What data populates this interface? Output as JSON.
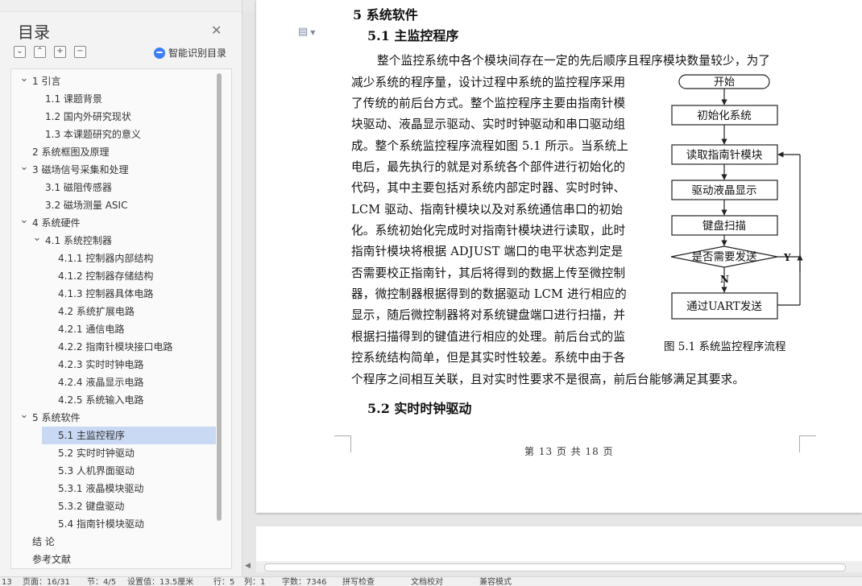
{
  "sidebar": {
    "title": "目录",
    "close_icon": "close-icon",
    "tools": [
      "⌄",
      "⌃",
      "+",
      "−"
    ],
    "ai_label": "智能识别目录",
    "selected_index": 19,
    "items": [
      {
        "label": "1  引言",
        "level": 0,
        "toggle": "expanded"
      },
      {
        "label": "1.1  课题背景",
        "level": 1
      },
      {
        "label": "1.2  国内外研究现状",
        "level": 1
      },
      {
        "label": "1.3  本课题研究的意义",
        "level": 1
      },
      {
        "label": "2  系统框图及原理",
        "level": 0
      },
      {
        "label": "3  磁场信号采集和处理",
        "level": 0,
        "toggle": "expanded"
      },
      {
        "label": "3.1  磁阻传感器",
        "level": 1
      },
      {
        "label": "3.2  磁场测量 ASIC",
        "level": 1
      },
      {
        "label": "4  系统硬件",
        "level": 0,
        "toggle": "expanded"
      },
      {
        "label": "4.1 系统控制器",
        "level": 1,
        "toggle": "expanded"
      },
      {
        "label": "4.1.1  控制器内部结构",
        "level": 2
      },
      {
        "label": "4.1.2  控制器存储结构",
        "level": 2
      },
      {
        "label": "4.1.3  控制器具体电路",
        "level": 2
      },
      {
        "label": "4.2  系统扩展电路",
        "level": 2
      },
      {
        "label": "4.2.1 通信电路",
        "level": 2
      },
      {
        "label": "4.2.2  指南针模块接口电路",
        "level": 2
      },
      {
        "label": "4.2.3  实时时钟电路",
        "level": 2
      },
      {
        "label": "4.2.4  液晶显示电路",
        "level": 2
      },
      {
        "label": "4.2.5 系统输入电路",
        "level": 2
      },
      {
        "label": "5  系统软件",
        "level": 0,
        "toggle": "expanded"
      },
      {
        "label": "5.1  主监控程序",
        "level": 2
      },
      {
        "label": "5.2  实时时钟驱动",
        "level": 2
      },
      {
        "label": "5.3  人机界面驱动",
        "level": 2
      },
      {
        "label": "5.3.1  液晶模块驱动",
        "level": 2
      },
      {
        "label": "5.3.2  键盘驱动",
        "level": 2
      },
      {
        "label": "5.4  指南针模块驱动",
        "level": 2
      },
      {
        "label": "结      论",
        "level": 0
      },
      {
        "label": "参考文献",
        "level": 0
      }
    ]
  },
  "document": {
    "cut_heading": "5  系统软件",
    "section_heading": "5.1  主监控程序",
    "paragraph_lines": [
      "整个监控系统中各个模块间存在一定的先后顺序且程序模块数量较少，为了",
      "减少系统的程序量，设计过程中系统的监控程序采用",
      "了传统的前后台方式。整个监控程序主要由指南针模",
      "块驱动、液晶显示驱动、实时时钟驱动和串口驱动组",
      "成。整个系统监控程序流程如图 5.1 所示。当系统上",
      "电后，最先执行的就是对系统各个部件进行初始化的",
      "代码，其中主要包括对系统内部定时器、实时时钟、",
      "LCM 驱动、指南针模块以及对系统通信串口的初始",
      "化。系统初始化完成时对指南针模块进行读取，此时",
      "指南针模块将根据 ADJUST 端口的电平状态判定是",
      "否需要校正指南针，其后将得到的数据上传至微控制",
      "器，微控制器根据得到的数据驱动 LCM 进行相应的",
      "显示，随后微控制器将对系统键盘端口进行扫描，并",
      "根据扫描得到的键值进行相应的处理。前后台式的监",
      "控系统结构简单，但是其实时性较差。系统中由于各",
      "个程序之间相互关联，且对实时性要求不是很高，前后台能够满足其要求。"
    ],
    "next_heading": "5.2  实时时钟驱动",
    "flowchart": {
      "start": "开始",
      "init": "初始化系统",
      "read": "读取指南针模块",
      "lcd": "驱动液晶显示",
      "keys": "键盘扫描",
      "decision": "是否需要发送",
      "yes": "Y",
      "no": "N",
      "send": "通过UART发送"
    },
    "figure_caption": "图  5.1    系统监控程序流程",
    "footer": "第 13 页 共 18 页"
  },
  "statusbar": {
    "items": [
      "13",
      "页面：16/31",
      "节：4/5",
      "设置值：13.5厘米",
      "行：5",
      "列：1",
      "字数：7346",
      "拼写检查",
      "文档校对",
      "兼容模式"
    ]
  }
}
